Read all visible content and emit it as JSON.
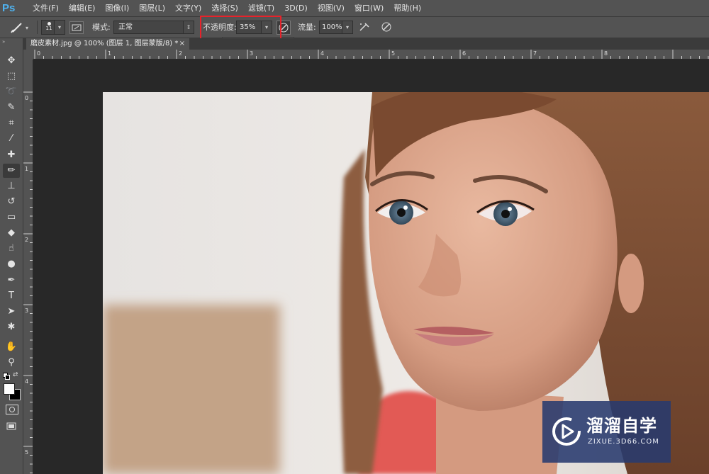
{
  "app": {
    "logo": "Ps"
  },
  "menu": [
    "文件(F)",
    "编辑(E)",
    "图像(I)",
    "图层(L)",
    "文字(Y)",
    "选择(S)",
    "滤镜(T)",
    "3D(D)",
    "视图(V)",
    "窗口(W)",
    "帮助(H)"
  ],
  "options": {
    "brush_size": "11",
    "mode_label": "模式:",
    "mode_value": "正常",
    "opacity_label": "不透明度:",
    "opacity_value": "35%",
    "opacity_slider_level": 0.35,
    "flow_label": "流量:",
    "flow_value": "100%"
  },
  "document": {
    "tab_title": "磨皮素材.jpg @ 100% (图层 1, 图层蒙版/8) *",
    "close": "×"
  },
  "ruler": {
    "h_ticks": [
      "0",
      "1",
      "2",
      "3",
      "4",
      "5",
      "6",
      "7",
      "8"
    ],
    "v_ticks": [
      "0",
      "1",
      "2",
      "3",
      "4",
      "5"
    ]
  },
  "tools": [
    {
      "name": "move-tool-icon",
      "glyph": "✥"
    },
    {
      "name": "marquee-tool-icon",
      "glyph": "⬚"
    },
    {
      "name": "lasso-tool-icon",
      "glyph": "➰"
    },
    {
      "name": "quick-select-tool-icon",
      "glyph": "✎"
    },
    {
      "name": "crop-tool-icon",
      "glyph": "⌗"
    },
    {
      "name": "eyedropper-tool-icon",
      "glyph": "⁄"
    },
    {
      "name": "healing-brush-tool-icon",
      "glyph": "✚"
    },
    {
      "name": "brush-tool-icon",
      "glyph": "✏",
      "active": true
    },
    {
      "name": "clone-stamp-tool-icon",
      "glyph": "⊥"
    },
    {
      "name": "history-brush-tool-icon",
      "glyph": "↺"
    },
    {
      "name": "eraser-tool-icon",
      "glyph": "▭"
    },
    {
      "name": "paint-bucket-tool-icon",
      "glyph": "◆"
    },
    {
      "name": "smudge-tool-icon",
      "glyph": "☝"
    },
    {
      "name": "sponge-tool-icon",
      "glyph": "●"
    },
    {
      "name": "pen-tool-icon",
      "glyph": "✒"
    },
    {
      "name": "type-tool-icon",
      "glyph": "T"
    },
    {
      "name": "path-select-tool-icon",
      "glyph": "➤"
    },
    {
      "name": "shape-tool-icon",
      "glyph": "✱"
    },
    {
      "name": "hand-tool-icon",
      "glyph": "✋"
    },
    {
      "name": "zoom-tool-icon",
      "glyph": "⚲"
    }
  ],
  "colors": {
    "foreground": "#ffffff",
    "background": "#000000",
    "highlight": "#e8222a"
  },
  "watermark": {
    "title": "溜溜自学",
    "url": "ZIXUE.3D66.COM"
  }
}
